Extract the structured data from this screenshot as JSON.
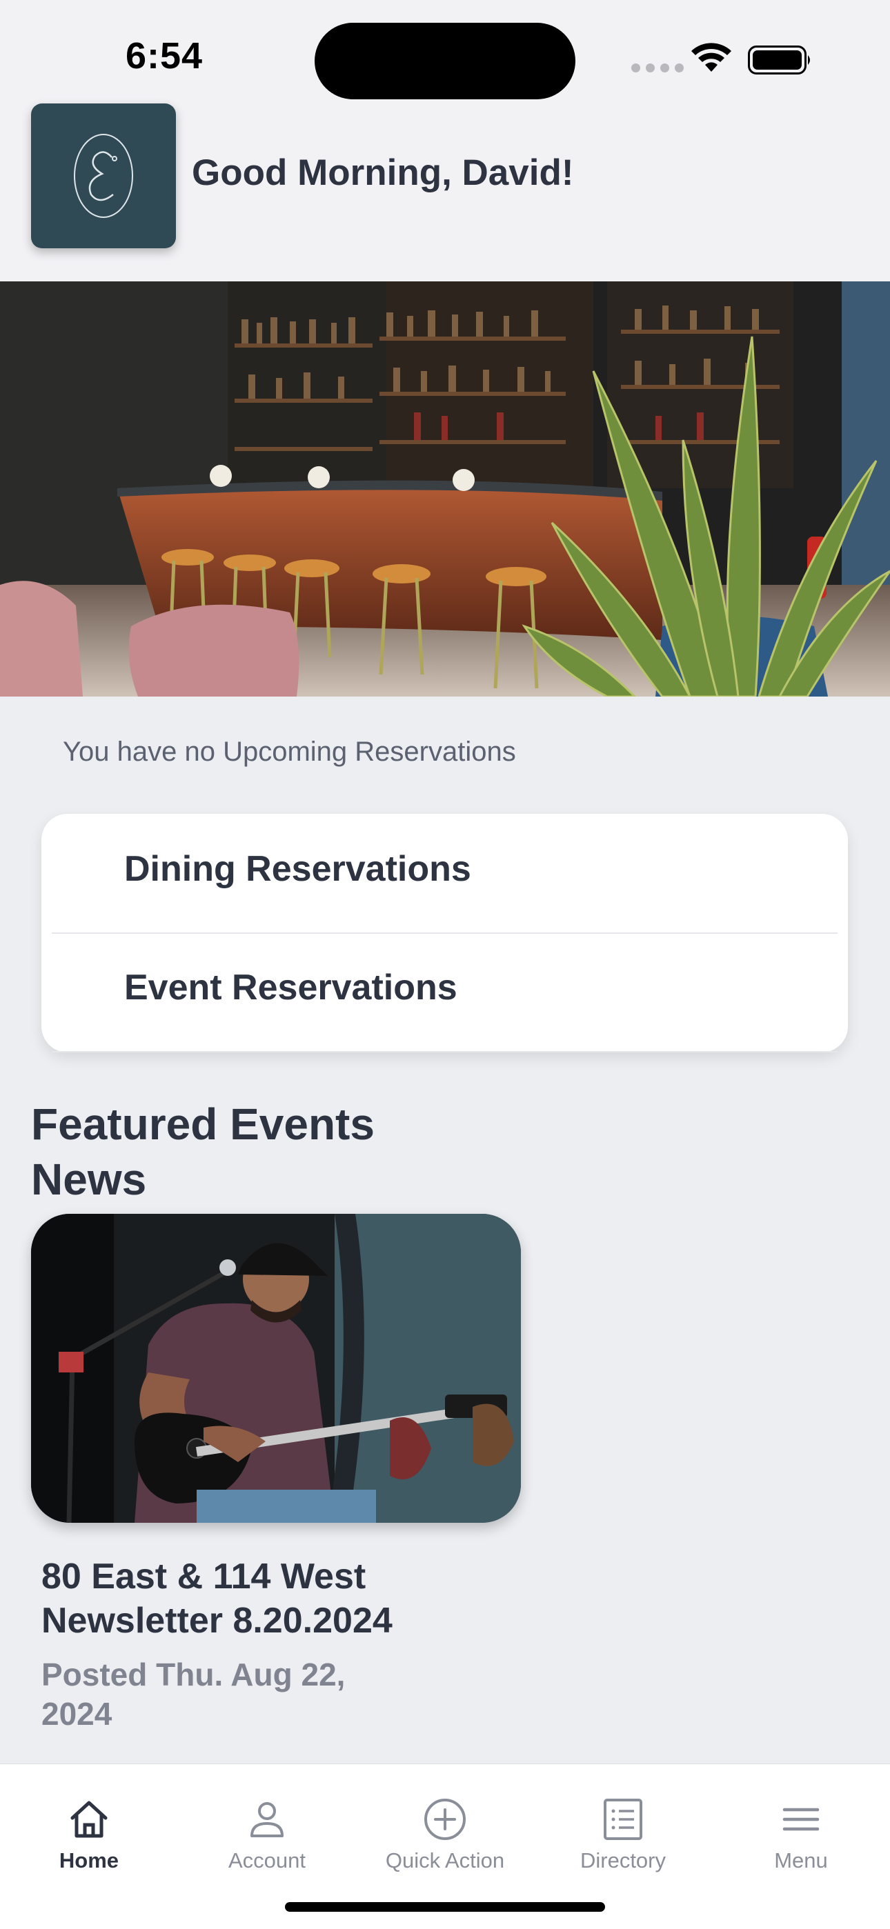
{
  "status_bar": {
    "time": "6:54"
  },
  "header": {
    "greeting": "Good Morning, David!"
  },
  "reservations": {
    "empty_message": "You have no Upcoming Reservations",
    "items": [
      {
        "label": "Dining Reservations"
      },
      {
        "label": "Event Reservations"
      }
    ]
  },
  "featured": {
    "title_line1": "Featured Events",
    "title_line2": "News",
    "article": {
      "title_line1": "80 East & 114 West",
      "title_line2": "Newsletter 8.20.2024",
      "date_line1": "Posted Thu. Aug 22,",
      "date_line2": "2024"
    }
  },
  "tabbar": {
    "tabs": [
      {
        "label": "Home",
        "icon": "home-icon",
        "active": true
      },
      {
        "label": "Account",
        "icon": "person-icon",
        "active": false
      },
      {
        "label": "Quick Action",
        "icon": "plus-circle-icon",
        "active": false
      },
      {
        "label": "Directory",
        "icon": "list-icon",
        "active": false
      },
      {
        "label": "Menu",
        "icon": "hamburger-icon",
        "active": false
      }
    ]
  },
  "colors": {
    "accent": "#2f4a55",
    "text": "#2d3340",
    "muted": "#8a8e98",
    "background": "#edeef2"
  }
}
